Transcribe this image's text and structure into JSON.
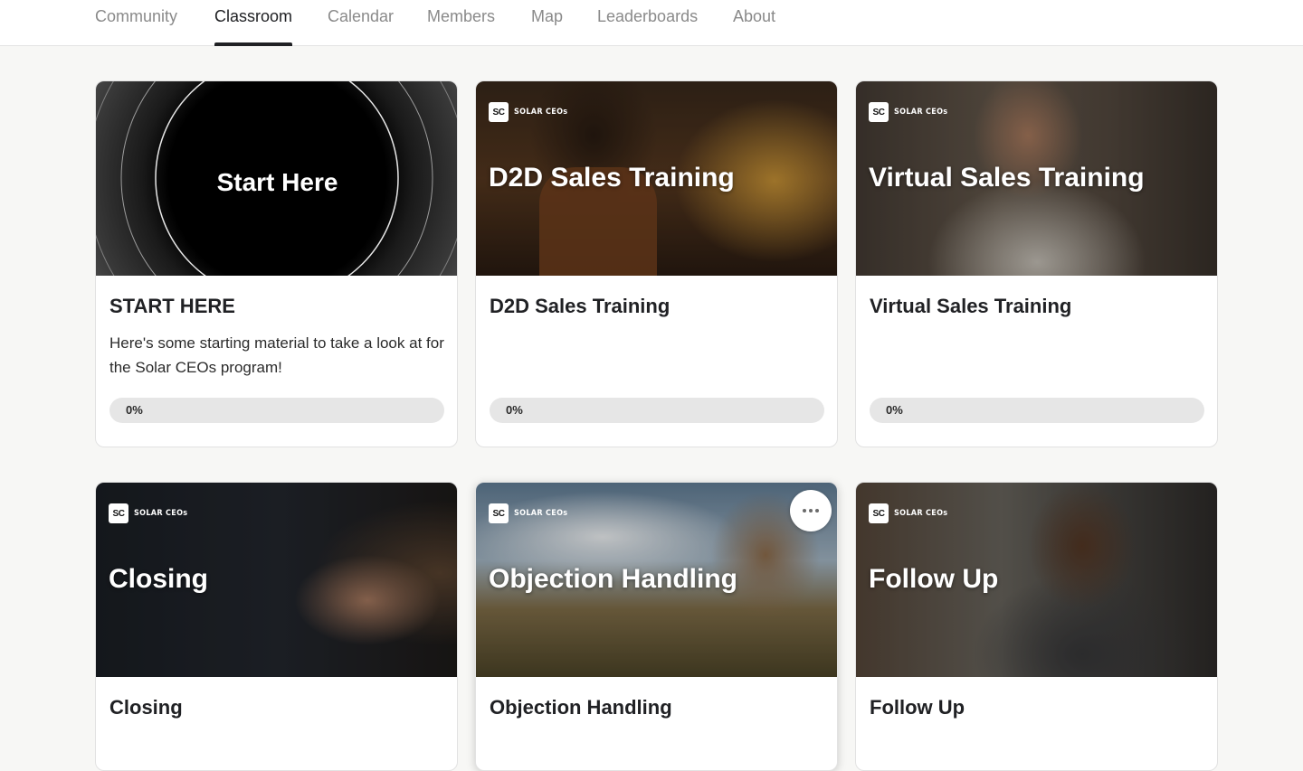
{
  "nav": {
    "tabs": [
      {
        "label": "Community",
        "active": false
      },
      {
        "label": "Classroom",
        "active": true
      },
      {
        "label": "Calendar",
        "active": false
      },
      {
        "label": "Members",
        "active": false
      },
      {
        "label": "Map",
        "active": false
      },
      {
        "label": "Leaderboards",
        "active": false
      },
      {
        "label": "About",
        "active": false
      }
    ]
  },
  "brand": {
    "logo_text": "SC",
    "name": "SOLAR CEOs"
  },
  "courses": [
    {
      "cover_title": "Start Here",
      "title": "START HERE",
      "description": "Here's some starting material to take a look at for the Solar CEOs program!",
      "progress": 0,
      "progress_label": "0%",
      "icon": "concentric-rings-cover"
    },
    {
      "cover_title": "D2D Sales Training",
      "title": "D2D Sales Training",
      "description": "",
      "progress": 0,
      "progress_label": "0%",
      "icon": "door-knocking-photo"
    },
    {
      "cover_title": "Virtual Sales Training",
      "title": "Virtual Sales Training",
      "description": "",
      "progress": 0,
      "progress_label": "0%",
      "icon": "smiling-man-photo"
    },
    {
      "cover_title": "Closing",
      "title": "Closing",
      "icon": "handshake-photo"
    },
    {
      "cover_title": "Objection Handling",
      "title": "Objection Handling",
      "icon": "boulder-push-photo"
    },
    {
      "cover_title": "Follow Up",
      "title": "Follow Up",
      "icon": "phone-call-photo"
    }
  ],
  "colors": {
    "accent": "#202124",
    "progress_track": "#e6e6e6",
    "progress_fill": "#f8d481",
    "page_bg": "#f7f7f5"
  }
}
